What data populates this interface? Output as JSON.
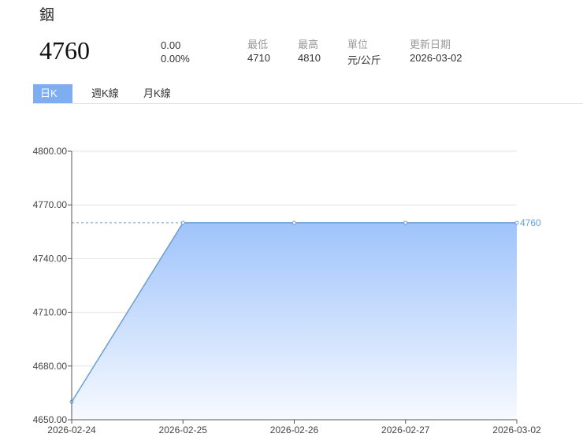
{
  "header": {
    "title": "銦",
    "price": "4760",
    "change": "0.00",
    "change_pct": "0.00%",
    "stats": [
      {
        "label": "最低",
        "value": "4710"
      },
      {
        "label": "最高",
        "value": "4810"
      },
      {
        "label": "單位",
        "value": "元/公斤"
      },
      {
        "label": "更新日期",
        "value": "2026-03-02"
      }
    ]
  },
  "tabs": [
    {
      "label": "日K線",
      "active": true
    },
    {
      "label": "週K線",
      "active": false
    },
    {
      "label": "月K線",
      "active": false
    }
  ],
  "chart_data": {
    "type": "area",
    "categories": [
      "2026-02-24",
      "2026-02-25",
      "2026-02-26",
      "2026-02-27",
      "2026-03-02"
    ],
    "values": [
      4660,
      4760,
      4760,
      4760,
      4760
    ],
    "ylim": [
      4650,
      4800
    ],
    "yticks": [
      "4650.00",
      "4680.00",
      "4710.00",
      "4740.00",
      "4770.00",
      "4800.00"
    ],
    "last_label": "4760",
    "line_color": "#6a9fd8",
    "fill_color": "#9fc3fb"
  }
}
